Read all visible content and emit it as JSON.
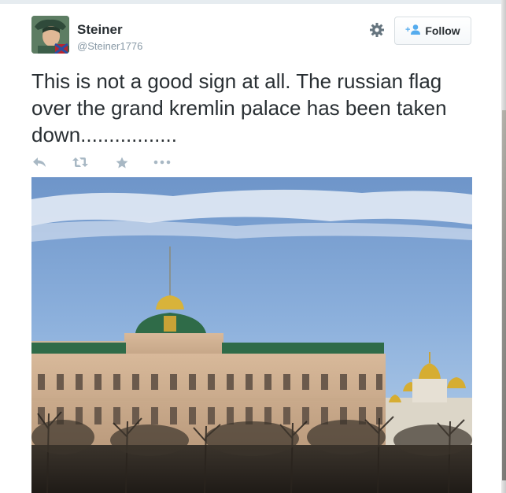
{
  "tweet": {
    "author": {
      "display_name": "Steiner",
      "screen_name": "@Steiner1776"
    },
    "follow_label": "Follow",
    "text": "This is not a good sign at all. The russian flag over the grand kremlin palace has been taken down.................",
    "actions": [
      "reply-icon",
      "retweet-icon",
      "favorite-icon",
      "more-icon"
    ]
  },
  "colors": {
    "text": "#292f33",
    "muted": "#8899a6",
    "icon": "#a8b8c4",
    "link": "#55acee"
  }
}
